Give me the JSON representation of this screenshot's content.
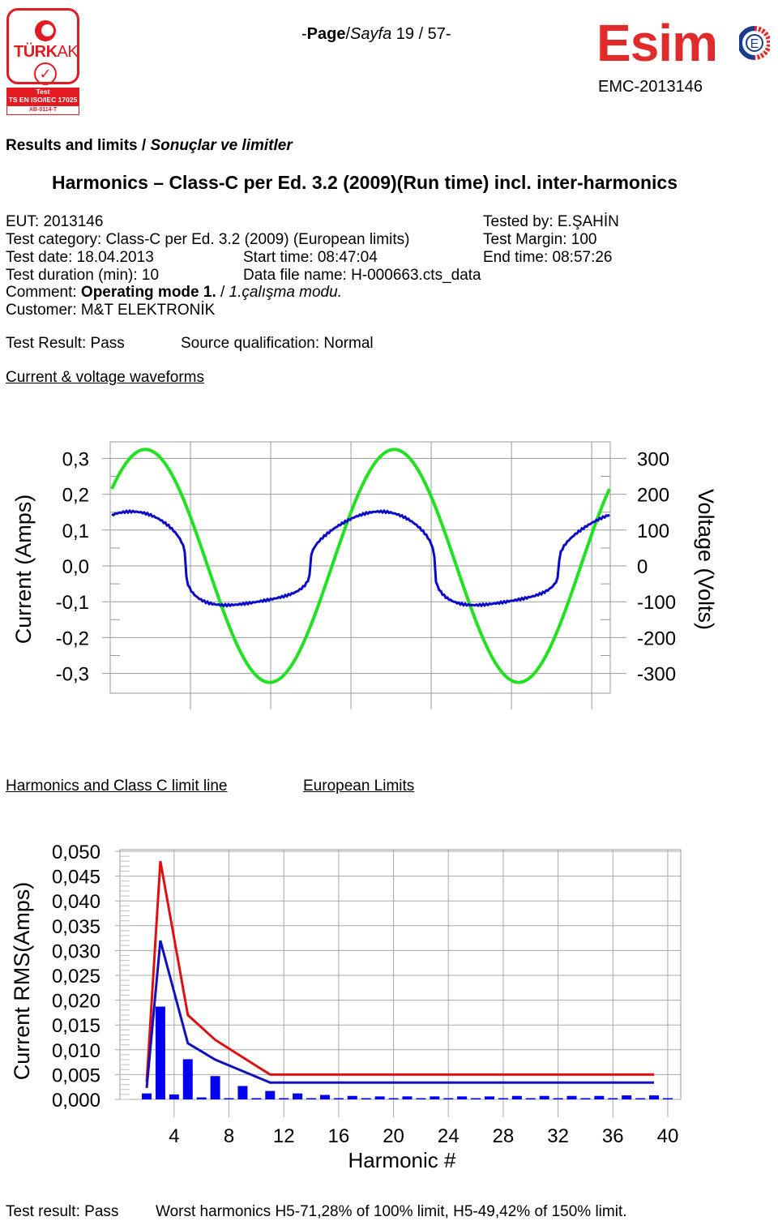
{
  "header": {
    "page_label_bold": "Page",
    "page_label_italic": "Sayfa",
    "page_prefix": "-",
    "page_sep": "/",
    "page_number": "19 / 57-",
    "report_code": "EMC-2013146",
    "logo_left": {
      "name": "TÜRKAK",
      "name_bold": "TÜRK",
      "name_light": "AK",
      "band_line1": "Test",
      "band_line2": "TS EN ISO/IEC 17025",
      "code": "AB-0114-T"
    },
    "logo_right": {
      "name": "Esim"
    }
  },
  "section_title_en": "Results and limits / ",
  "section_title_tr": "Sonuçlar ve limitler",
  "main_title": "Harmonics – Class-C per Ed. 3.2 (2009)(Run time) incl. inter-harmonics",
  "info": {
    "eut": "EUT: 2013146",
    "tested_by": "Tested by: E.ŞAHİN",
    "test_category": "Test category: Class-C per Ed. 3.2 (2009) (European limits)",
    "test_margin": "Test Margin: 100",
    "test_date": "Test date: 18.04.2013",
    "start_time": "Start time: 08:47:04",
    "end_time": "End time: 08:57:26",
    "test_duration": "Test duration (min): 10",
    "data_file": "Data file name: H-000663.cts_data",
    "comment_label": "Comment: ",
    "comment_bold": "Operating mode 1.",
    "comment_sep": " / ",
    "comment_italic": "1.çalışma modu.",
    "customer": "Customer: M&T ELEKTRONİK",
    "test_result": "Test Result: Pass",
    "source_qualification": "Source qualification: Normal"
  },
  "waveform_section_title": "Current & voltage waveforms",
  "harmonics_section_title": "Harmonics and Class C limit line",
  "limits_section_title": "European Limits",
  "footer": {
    "result": "Test result:  Pass",
    "worst": "Worst harmonics H5-71,28% of 100% limit, H5-49,42% of 150% limit."
  },
  "chart_data": [
    {
      "type": "line",
      "title": "Current & voltage waveforms",
      "ylabel": "Current (Amps)",
      "y2label": "Voltage (Volts)",
      "ylim": [
        -0.35,
        0.35
      ],
      "y2lim": [
        -350,
        350
      ],
      "yticks": [
        "0,3",
        "0,2",
        "0,1",
        "0,0",
        "-0,1",
        "-0,2",
        "-0,3"
      ],
      "y2ticks": [
        "300",
        "200",
        "100",
        "0",
        "-100",
        "-200",
        "-300"
      ],
      "x_range_cycles": [
        0,
        2.0
      ],
      "x_gridlines": 6,
      "grid": true,
      "series": [
        {
          "name": "Voltage",
          "axis": "right",
          "color": "#22e022",
          "shape": "sine",
          "peak": 325,
          "start_value": 215,
          "cycles": 2.0
        },
        {
          "name": "Current",
          "axis": "left",
          "color": "#0a0ac8",
          "shape": "flattened-sine",
          "peak": 0.155,
          "start_value": 0.155,
          "cycles": 2.0
        }
      ]
    },
    {
      "type": "bar",
      "title": "Harmonics and Class C limit line",
      "xlabel": "Harmonic #",
      "ylabel": "Current RMS(Amps)",
      "xlim": [
        1,
        41
      ],
      "ylim": [
        0,
        0.05
      ],
      "xticks": [
        "4",
        "8",
        "12",
        "16",
        "20",
        "24",
        "28",
        "32",
        "36",
        "40"
      ],
      "yticks": [
        "0,050",
        "0,045",
        "0,040",
        "0,035",
        "0,030",
        "0,025",
        "0,020",
        "0,015",
        "0,010",
        "0,005",
        "0,000"
      ],
      "grid": true,
      "categories": [
        2,
        3,
        4,
        5,
        6,
        7,
        8,
        9,
        10,
        11,
        12,
        13,
        14,
        15,
        16,
        17,
        18,
        19,
        20,
        21,
        22,
        23,
        24,
        25,
        26,
        27,
        28,
        29,
        30,
        31,
        32,
        33,
        34,
        35,
        36,
        37,
        38,
        39,
        40
      ],
      "values": [
        0.0012,
        0.0187,
        0.001,
        0.0081,
        0.0004,
        0.0047,
        0.0002,
        0.0027,
        0.0002,
        0.0017,
        0.0002,
        0.0012,
        0.0002,
        0.0009,
        0.0002,
        0.0007,
        0.0002,
        0.0006,
        0.0002,
        0.0006,
        0.0002,
        0.0006,
        0.0002,
        0.0006,
        0.0002,
        0.0006,
        0.0002,
        0.0007,
        0.0002,
        0.0007,
        0.0002,
        0.0007,
        0.0002,
        0.0007,
        0.0002,
        0.0008,
        0.0002,
        0.0008,
        0.0002
      ],
      "bar_color": "#0000ee",
      "limit_lines": [
        {
          "name": "150% limit",
          "color": "#e01010",
          "x": [
            2,
            3,
            5,
            7,
            9,
            11,
            13,
            15,
            17,
            19,
            21,
            23,
            25,
            27,
            29,
            31,
            33,
            35,
            37,
            39
          ],
          "values": [
            0.0035,
            0.048,
            0.017,
            0.012,
            0.0085,
            0.005,
            0.005,
            0.005,
            0.005,
            0.005,
            0.005,
            0.005,
            0.005,
            0.005,
            0.005,
            0.005,
            0.005,
            0.005,
            0.005,
            0.005
          ]
        },
        {
          "name": "100% limit",
          "color": "#1010c0",
          "x": [
            2,
            3,
            5,
            7,
            9,
            11,
            13,
            15,
            17,
            19,
            21,
            23,
            25,
            27,
            29,
            31,
            33,
            35,
            37,
            39
          ],
          "values": [
            0.0023,
            0.032,
            0.0113,
            0.008,
            0.0057,
            0.0034,
            0.0034,
            0.0034,
            0.0034,
            0.0034,
            0.0034,
            0.0034,
            0.0034,
            0.0034,
            0.0034,
            0.0034,
            0.0034,
            0.0034,
            0.0034,
            0.0034
          ]
        }
      ]
    }
  ]
}
